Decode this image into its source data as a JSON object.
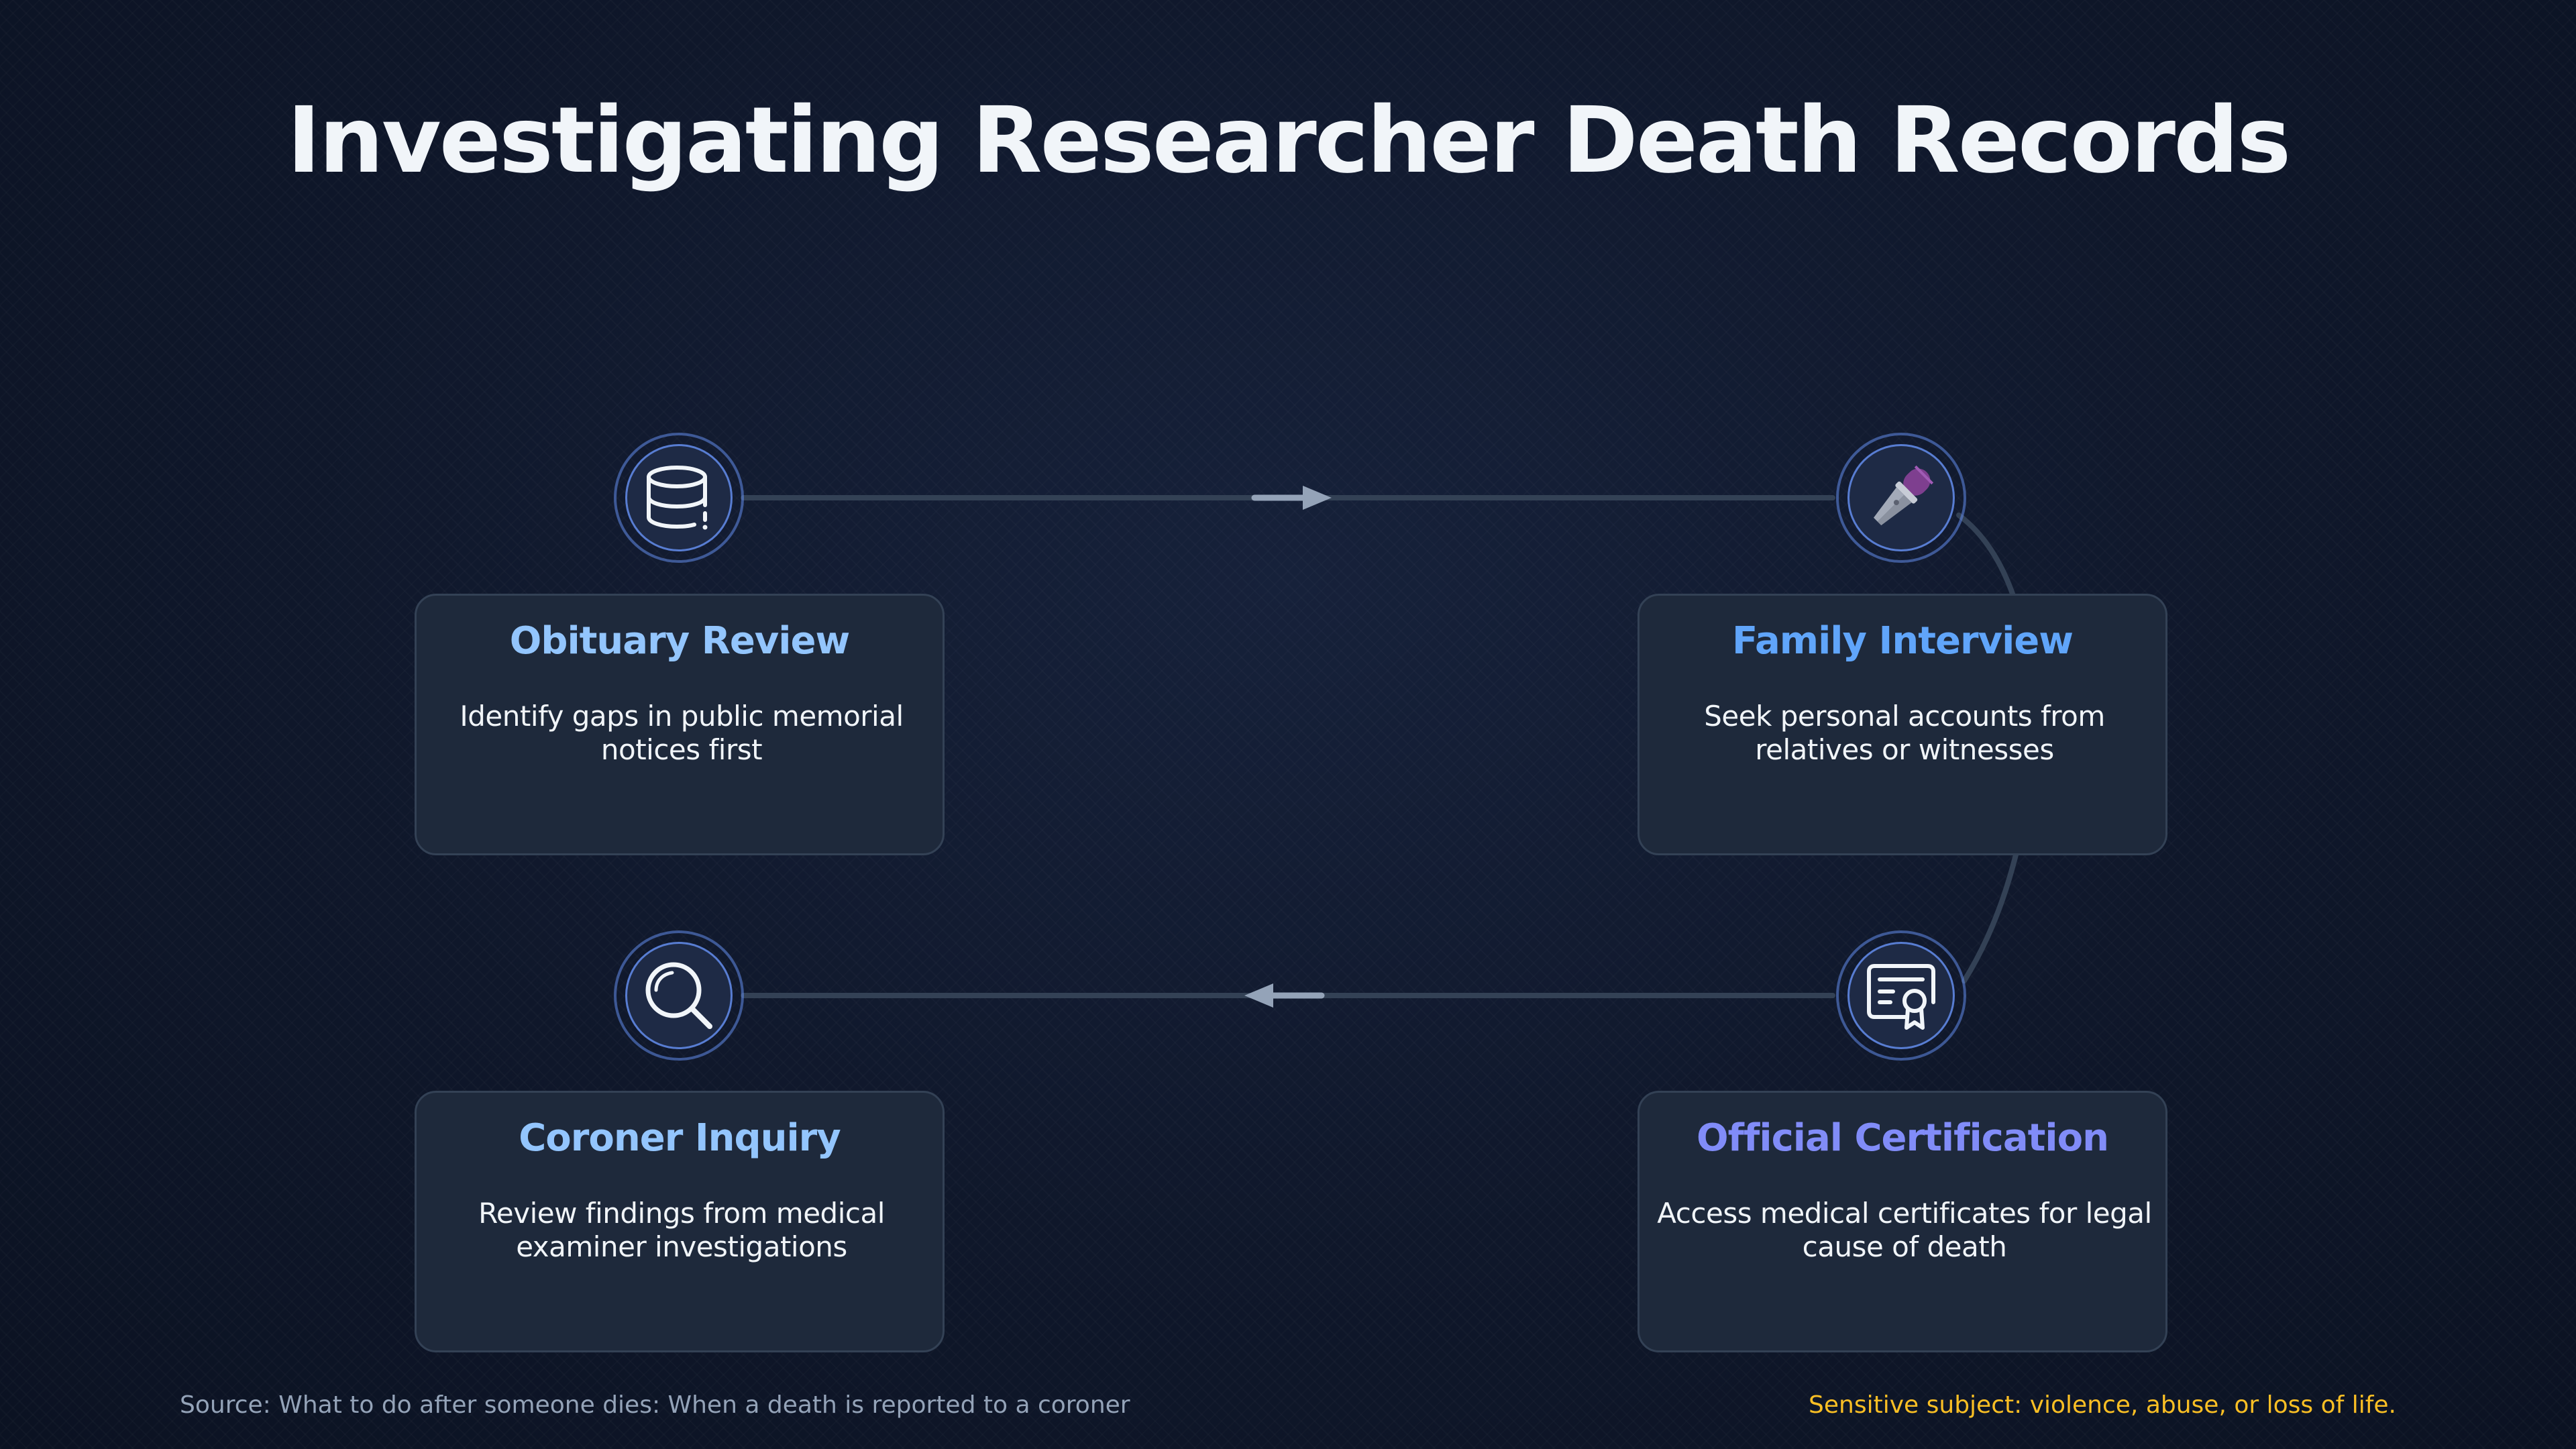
{
  "title": "Investigating Researcher Death Records",
  "steps": [
    {
      "title": "Obituary Review",
      "description": "Identify gaps in public memorial notices first",
      "icon": "database-icon",
      "color": "#93c5fd"
    },
    {
      "title": "Family Interview",
      "description": "Seek personal accounts from relatives or witnesses",
      "icon": "microphone-icon",
      "color": "#60a5fa"
    },
    {
      "title": "Official Certification",
      "description": "Access medical certificates for legal cause of death",
      "icon": "certificate-icon",
      "color": "#818cf8"
    },
    {
      "title": "Coroner Inquiry",
      "description": "Review findings from medical examiner investigations",
      "icon": "magnifier-icon",
      "color": "#93c5fd"
    }
  ],
  "footer": {
    "source": "Source: What to do after someone dies: When a death is reported to a coroner",
    "warning": "Sensitive subject: violence, abuse, or loss of life."
  },
  "colors": {
    "background": "#0f172a",
    "card": "#1e293b",
    "connector": "#334155",
    "arrow": "#94a3b8",
    "warning": "#fbbf24"
  }
}
